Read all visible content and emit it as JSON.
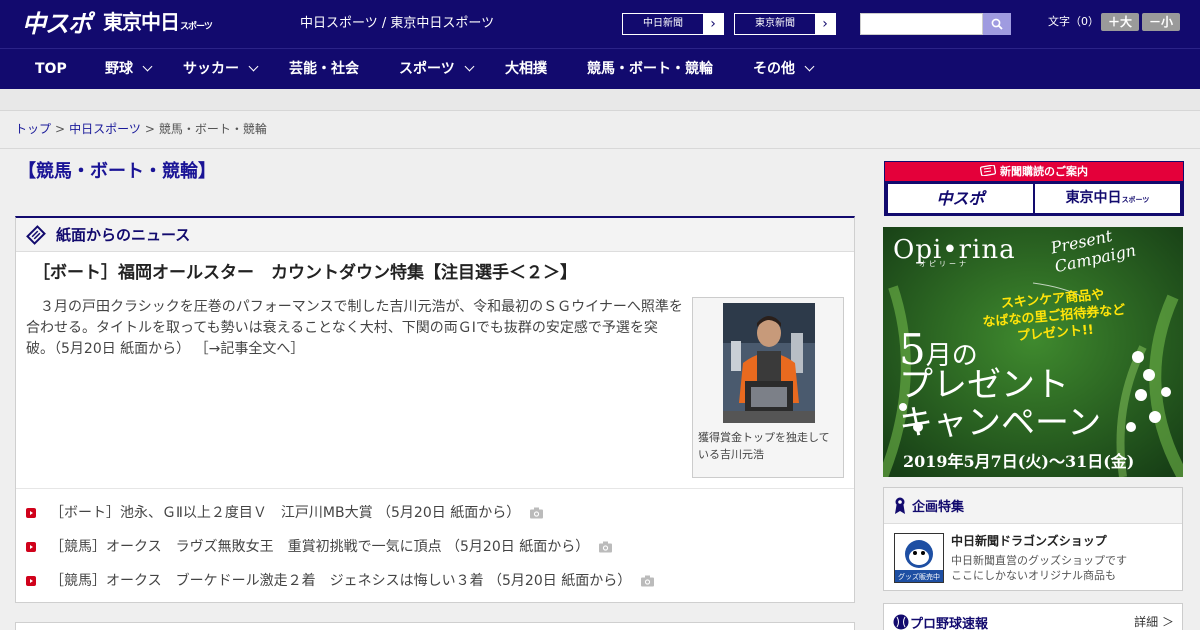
{
  "header": {
    "logo_chuspo": "中スポ",
    "logo_tokyo": "東京中日",
    "logo_tokyo_small": "スポーツ",
    "site_links": "中日スポーツ / 東京中日スポーツ",
    "paper_buttons": [
      "中日新聞",
      "東京新聞"
    ],
    "search_placeholder": "",
    "font_label": "文字（0）",
    "font_up": "＋大",
    "font_down": "－小",
    "brand_color": "#120a6e"
  },
  "nav": {
    "items": [
      {
        "label": "TOP",
        "dropdown": false
      },
      {
        "label": "野球",
        "dropdown": true
      },
      {
        "label": "サッカー",
        "dropdown": true
      },
      {
        "label": "芸能・社会",
        "dropdown": false
      },
      {
        "label": "スポーツ",
        "dropdown": true
      },
      {
        "label": "大相撲",
        "dropdown": false
      },
      {
        "label": "競馬・ボート・競輪",
        "dropdown": false
      },
      {
        "label": "その他",
        "dropdown": true
      }
    ]
  },
  "breadcrumb": {
    "items": [
      "トップ",
      "中日スポーツ",
      "競馬・ボート・競輪"
    ],
    "separator": ">"
  },
  "page": {
    "title": "【競馬・ボート・競輪】"
  },
  "news": {
    "section_title": "紙面からのニュース",
    "lead": {
      "title": "［ボート］福岡オールスター　カウントダウン特集【注目選手＜２＞】",
      "body": "　３月の戸田クラシックを圧巻のパフォーマンスで制した吉川元浩が、令和最初のＳＧウイナーへ照準を合わせる。タイトルを取っても勢いは衰えることなく大村、下関の両ＧⅠでも抜群の安定感で予選を突破。（5月20日 紙面から）",
      "more": "［→記事全文へ］",
      "photo_caption": "獲得賞金トップを独走している吉川元浩"
    },
    "items": [
      {
        "text": "［ボート］池永、ＧⅡ以上２度目Ｖ　江戸川MB大賞 （5月20日 紙面から）",
        "has_photo": true
      },
      {
        "text": "［競馬］オークス　ラヴズ無敗女王　重賞初挑戦で一気に頂点 （5月20日 紙面から）",
        "has_photo": true
      },
      {
        "text": "［競馬］オークス　ブーケドール激走２着　ジェネシスは悔しい３着 （5月20日 紙面から）",
        "has_photo": true
      }
    ]
  },
  "sidebar": {
    "subscribe_title": "新聞購読のご案内",
    "subscribe_buttons": [
      "中スポ",
      "東京中日"
    ],
    "subscribe_small": "スポーツ",
    "ad": {
      "brand": "Opi•rina",
      "brand_sub": "オピリーナ",
      "campaign": "Present Campaign",
      "lines": [
        "スキンケア商品や",
        "なばなの里ご招待券など",
        "プレゼント!!"
      ],
      "big_num": "5",
      "big_suffix": "月の",
      "big_line2": "プレゼント",
      "big_line3": "キャンペーン",
      "date": "2019年5月7日(火)〜31日(金)"
    },
    "feature": {
      "section_title": "企画特集",
      "title": "中日新聞ドラゴンズショップ",
      "desc_line1": "中日新聞直営のグッズショップです",
      "desc_line2": "ここにしかないオリジナル商品も",
      "thumb_text": "グッズ販売中"
    },
    "npb": {
      "title": "プロ野球速報",
      "more": "詳細 ＞"
    }
  }
}
